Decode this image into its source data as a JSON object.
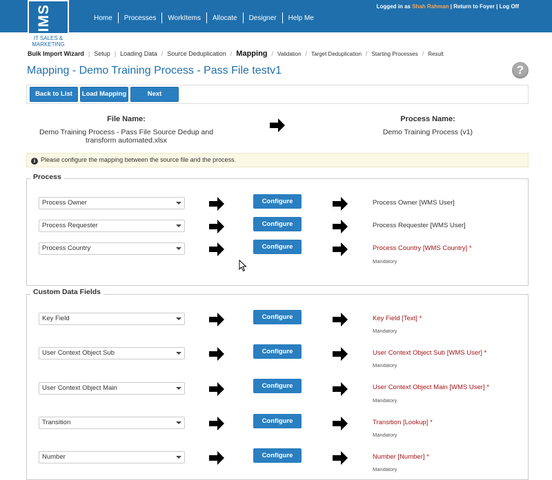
{
  "logo": {
    "text": "EIMS",
    "line1": "IT SALES &",
    "line2": "MARKETING"
  },
  "nav": [
    "Home",
    "Processes",
    "WorkItems",
    "Allocate",
    "Designer",
    "Help Me"
  ],
  "user": {
    "prefix": "Logged in as",
    "name": "Shah Rahman",
    "sep1": "|",
    "foyer": "Return to Foyer",
    "sep2": "|",
    "logoff": "Log Off"
  },
  "wizard": {
    "title": "Bulk Import Wizard",
    "steps": [
      "Setup",
      "Loading Data",
      "Source Deduplication",
      "Mapping",
      "Validation",
      "Target Deduplication",
      "Starting Processes",
      "Result"
    ],
    "active": "Mapping"
  },
  "page_title": "Mapping - Demo Training Process - Pass File testv1",
  "help_icon": "?",
  "buttons": {
    "back": "Back to List",
    "load": "Load Mapping",
    "next": "Next"
  },
  "file": {
    "label": "File Name:",
    "value_line1": "Demo Training Process - Pass File Source Dedup and",
    "value_line2": "transform automated.xlsx"
  },
  "process": {
    "label": "Process Name:",
    "value": "Demo Training Process (v1)"
  },
  "notice": "Please configure the mapping between the source file and the process.",
  "configure_label": "Configure",
  "mandatory_label": "Mandatory",
  "process_section": {
    "legend": "Process",
    "rows": [
      {
        "source": "Process Owner",
        "target": "Process Owner [WMS User]",
        "required": false
      },
      {
        "source": "Process Requester",
        "target": "Process Requester [WMS User]",
        "required": false
      },
      {
        "source": "Process Country",
        "target": "Process Country [WMS Country] *",
        "required": true
      }
    ]
  },
  "custom_section": {
    "legend": "Custom Data Fields",
    "rows": [
      {
        "source": "Key Field",
        "target": "Key Field [Text] *",
        "required": true
      },
      {
        "source": "User Context Object Sub",
        "target": "User Context Object Sub [WMS User] *",
        "required": true
      },
      {
        "source": "User Context Object Main",
        "target": "User Context Object Main [WMS User] *",
        "required": true
      },
      {
        "source": "Transition",
        "target": "Transition [Lookup] *",
        "required": true
      },
      {
        "source": "Number",
        "target": "Number [Number] *",
        "required": true
      }
    ]
  },
  "colors": {
    "brand": "#1f6fad",
    "button": "#2a7fc0",
    "required": "#a4161a",
    "notice_bg": "#fbf8e6"
  }
}
